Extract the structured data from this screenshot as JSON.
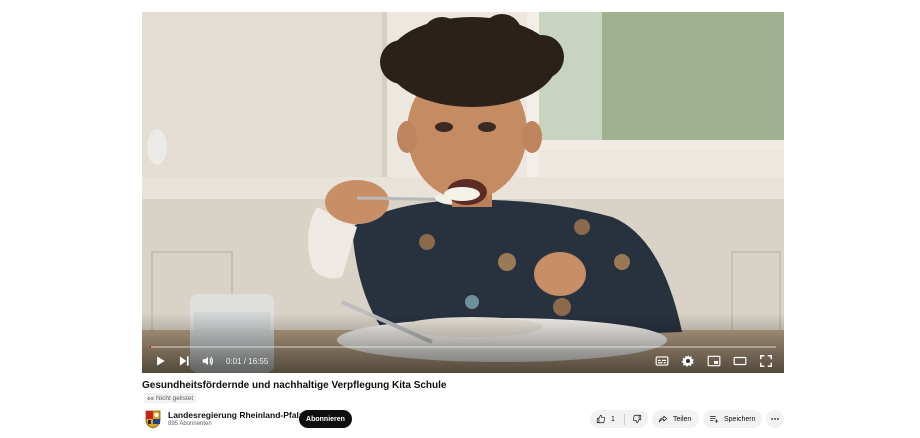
{
  "video": {
    "current_time": "0:01",
    "duration": "16:55",
    "time_separator": " / ",
    "progress_percent": 0.1
  },
  "title": "Gesundheitsfördernde und nachhaltige Verpflegung Kita Schule",
  "visibility_label": "Nicht gelistet",
  "channel": {
    "name": "Landesregierung Rheinland-Pfalz",
    "subscribers": "895 Abonnenten",
    "subscribe_label": "Abonnieren"
  },
  "actions": {
    "like_count": "1",
    "share_label": "Teilen",
    "save_label": "Speichern"
  },
  "colors": {
    "progress": "#ff0000",
    "subscribe_bg": "#0f0f0f",
    "pill_bg": "#f2f2f2"
  },
  "icons": [
    "play-icon",
    "next-icon",
    "volume-icon",
    "subtitles-icon",
    "settings-icon",
    "miniplayer-icon",
    "theater-icon",
    "fullscreen-icon",
    "link-icon",
    "thumbs-up-icon",
    "thumbs-down-icon",
    "share-icon",
    "save-icon",
    "more-icon",
    "coat-of-arms-icon"
  ]
}
